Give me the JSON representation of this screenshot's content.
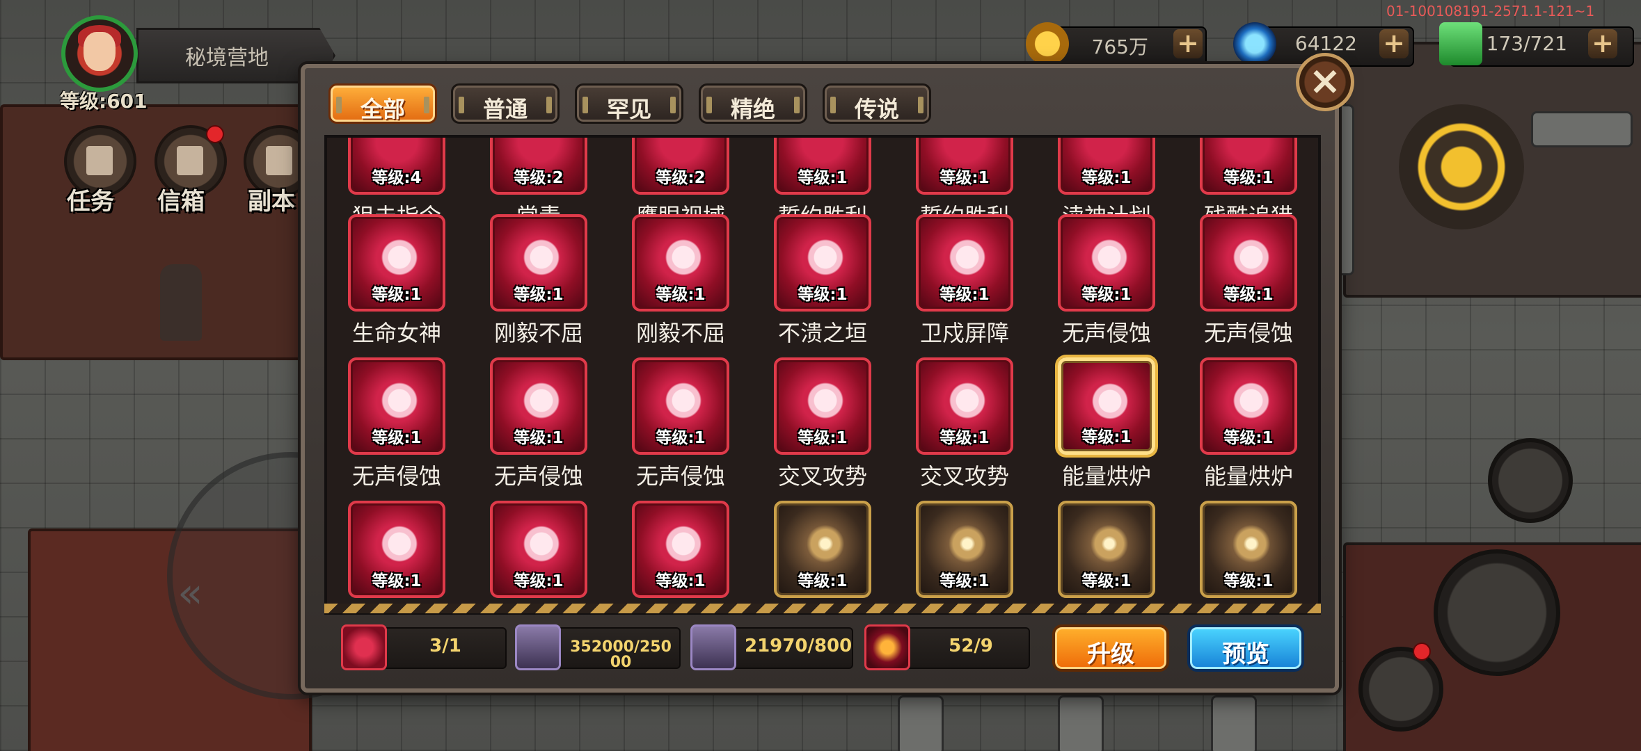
{
  "hud": {
    "location": "秘境营地",
    "level": "等级:601",
    "side_buttons": [
      {
        "label": "任务"
      },
      {
        "label": "信箱"
      },
      {
        "label": "副本"
      }
    ]
  },
  "version_text": "01-100108191-2571.1-121~1",
  "resources": [
    {
      "name": "gold",
      "value": "765万",
      "color": "#f0b62a"
    },
    {
      "name": "gem",
      "value": "64122",
      "color": "#3aa0e0"
    },
    {
      "name": "stamina",
      "value": "173/721",
      "color": "#3fb24a"
    }
  ],
  "tabs": [
    {
      "label": "全部",
      "active": true
    },
    {
      "label": "普通",
      "active": false
    },
    {
      "label": "罕见",
      "active": false
    },
    {
      "label": "精绝",
      "active": false
    },
    {
      "label": "传说",
      "active": false
    }
  ],
  "top_row": [
    {
      "lv": "等级:4",
      "name": "狙击指令"
    },
    {
      "lv": "等级:2",
      "name": "常青"
    },
    {
      "lv": "等级:2",
      "name": "鹰眼视域"
    },
    {
      "lv": "等级:1",
      "name": "誓约胜利"
    },
    {
      "lv": "等级:1",
      "name": "誓约胜利"
    },
    {
      "lv": "等级:1",
      "name": "渎神计划"
    },
    {
      "lv": "等级:1",
      "name": "残酷追猎"
    }
  ],
  "rows": [
    [
      {
        "lv": "等级:1",
        "name": "生命女神",
        "style": "red",
        "icon": "tree-icon"
      },
      {
        "lv": "等级:1",
        "name": "刚毅不屈",
        "style": "red",
        "icon": "knight-helmet-icon"
      },
      {
        "lv": "等级:1",
        "name": "刚毅不屈",
        "style": "red",
        "icon": "knight-helmet-icon"
      },
      {
        "lv": "等级:1",
        "name": "不溃之垣",
        "style": "red",
        "icon": "castle-icon"
      },
      {
        "lv": "等级:1",
        "name": "卫戍屏障",
        "style": "red",
        "icon": "shield-orb-icon"
      },
      {
        "lv": "等级:1",
        "name": "无声侵蚀",
        "style": "red",
        "icon": "bat-web-icon"
      },
      {
        "lv": "等级:1",
        "name": "无声侵蚀",
        "style": "red",
        "icon": "bat-web-icon"
      }
    ],
    [
      {
        "lv": "等级:1",
        "name": "无声侵蚀",
        "style": "red",
        "icon": "bat-web-icon"
      },
      {
        "lv": "等级:1",
        "name": "无声侵蚀",
        "style": "red",
        "icon": "bat-web-icon"
      },
      {
        "lv": "等级:1",
        "name": "无声侵蚀",
        "style": "red",
        "icon": "bat-web-icon"
      },
      {
        "lv": "等级:1",
        "name": "交叉攻势",
        "style": "red",
        "icon": "crossed-blades-icon"
      },
      {
        "lv": "等级:1",
        "name": "交叉攻势",
        "style": "red",
        "icon": "crossed-blades-icon"
      },
      {
        "lv": "等级:1",
        "name": "能量烘炉",
        "style": "red",
        "icon": "energy-furnace-icon",
        "selected": true
      },
      {
        "lv": "等级:1",
        "name": "能量烘炉",
        "style": "red",
        "icon": "energy-furnace-icon"
      }
    ],
    [
      {
        "lv": "等级:1",
        "name": "",
        "style": "red",
        "icon": "energy-furnace-icon"
      },
      {
        "lv": "等级:1",
        "name": "",
        "style": "red",
        "icon": "energy-furnace-icon"
      },
      {
        "lv": "等级:1",
        "name": "",
        "style": "red",
        "icon": "tower-w-icon"
      },
      {
        "lv": "等级:1",
        "name": "",
        "style": "gold",
        "icon": "slash-icon"
      },
      {
        "lv": "等级:1",
        "name": "",
        "style": "gold",
        "icon": "slash-icon"
      },
      {
        "lv": "等级:1",
        "name": "",
        "style": "gold",
        "icon": "slash-icon"
      },
      {
        "lv": "等级:1",
        "name": "",
        "style": "gold",
        "icon": "swirl-icon"
      }
    ]
  ],
  "footer": {
    "costs": [
      {
        "icon": "energy-furnace-icon",
        "value": "3/1"
      },
      {
        "icon": "weapon-crate-icon",
        "value": "352000/250\n00"
      },
      {
        "icon": "metal-ingot-icon",
        "value": "21970/800"
      },
      {
        "icon": "energy-core-icon",
        "value": "52/9"
      }
    ],
    "upgrade_label": "升级",
    "preview_label": "预览"
  }
}
